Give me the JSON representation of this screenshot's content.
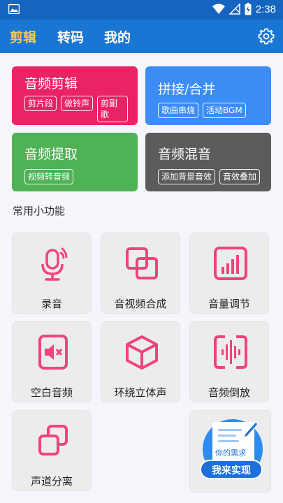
{
  "status_bar": {
    "time": "2:38"
  },
  "tabs": [
    {
      "label": "剪辑",
      "active": true
    },
    {
      "label": "转码",
      "active": false
    },
    {
      "label": "我的",
      "active": false
    }
  ],
  "feature_cards": [
    {
      "title": "音频剪辑",
      "tags": [
        "剪片段",
        "做铃声",
        "剪副歌"
      ],
      "color": "#ea2365"
    },
    {
      "title": "拼接/合并",
      "tags": [
        "歌曲串烧",
        "活动BGM"
      ],
      "color": "#3b8cf5"
    },
    {
      "title": "音频提取",
      "tags": [
        "视频转音频"
      ],
      "color": "#4fb255"
    },
    {
      "title": "音频混音",
      "tags": [
        "添加背景音效",
        "音效叠加"
      ],
      "color": "#5b5b5b"
    }
  ],
  "section_title": "常用小功能",
  "tools": [
    {
      "label": "录音",
      "icon": "microphone-icon"
    },
    {
      "label": "音视频合成",
      "icon": "overlap-squares-icon"
    },
    {
      "label": "音量调节",
      "icon": "volume-bars-icon"
    },
    {
      "label": "空白音频",
      "icon": "mute-doc-icon"
    },
    {
      "label": "环绕立体声",
      "icon": "cube-icon"
    },
    {
      "label": "音频倒放",
      "icon": "waveform-icon"
    },
    {
      "label": "声道分离",
      "icon": "split-squares-icon"
    }
  ],
  "promo": {
    "needs_text": "你的需求",
    "cta": "我来实现"
  },
  "colors": {
    "accent_pink": "#f2437a",
    "app_bar": "#1976d2",
    "tab_active": "#f8c55a"
  }
}
